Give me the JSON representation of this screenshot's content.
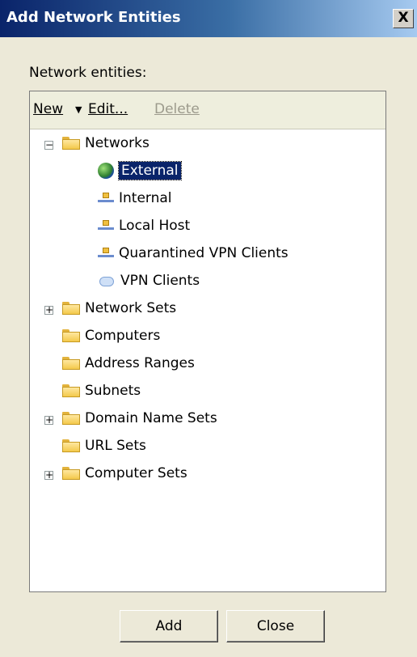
{
  "window": {
    "title": "Add Network Entities",
    "close_glyph": "X"
  },
  "section_label": "Network entities:",
  "toolbar": {
    "new_label": "New",
    "new_arrow": "▼",
    "edit_label": "Edit...",
    "delete_label": "Delete"
  },
  "tree": {
    "networks": "Networks",
    "external": "External",
    "internal": "Internal",
    "local_host": "Local Host",
    "quarantined": "Quarantined VPN Clients",
    "vpn_clients": "VPN Clients",
    "network_sets": "Network Sets",
    "computers": "Computers",
    "address_ranges": "Address Ranges",
    "subnets": "Subnets",
    "domain_name_sets": "Domain Name Sets",
    "url_sets": "URL Sets",
    "computer_sets": "Computer Sets",
    "collapse_glyph": "−",
    "expand_glyph": "+"
  },
  "buttons": {
    "add": "Add",
    "close": "Close"
  }
}
